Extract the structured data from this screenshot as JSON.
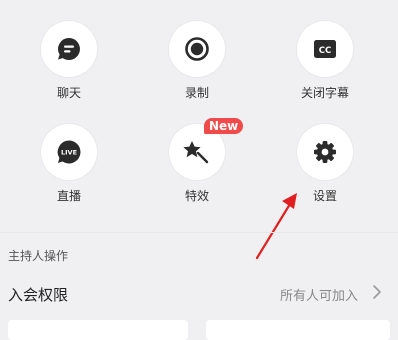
{
  "actions": [
    {
      "label": "聊天",
      "icon": "chat-bubble-icon"
    },
    {
      "label": "录制",
      "icon": "record-icon"
    },
    {
      "label": "关闭字幕",
      "icon": "closed-captions-icon"
    },
    {
      "label": "直播",
      "icon": "live-icon"
    },
    {
      "label": "特效",
      "icon": "magic-wand-icon",
      "badge": "New"
    },
    {
      "label": "设置",
      "icon": "settings-gear-icon"
    }
  ],
  "live_icon_text": "LIVE",
  "cc_icon_text": "CC",
  "host": {
    "section_title": "主持人操作",
    "join_permission_label": "入会权限",
    "join_permission_value": "所有人可加入"
  },
  "colors": {
    "badge": "#f04a4a",
    "annotation_arrow": "#e02020",
    "icon": "#2b2b2b"
  }
}
